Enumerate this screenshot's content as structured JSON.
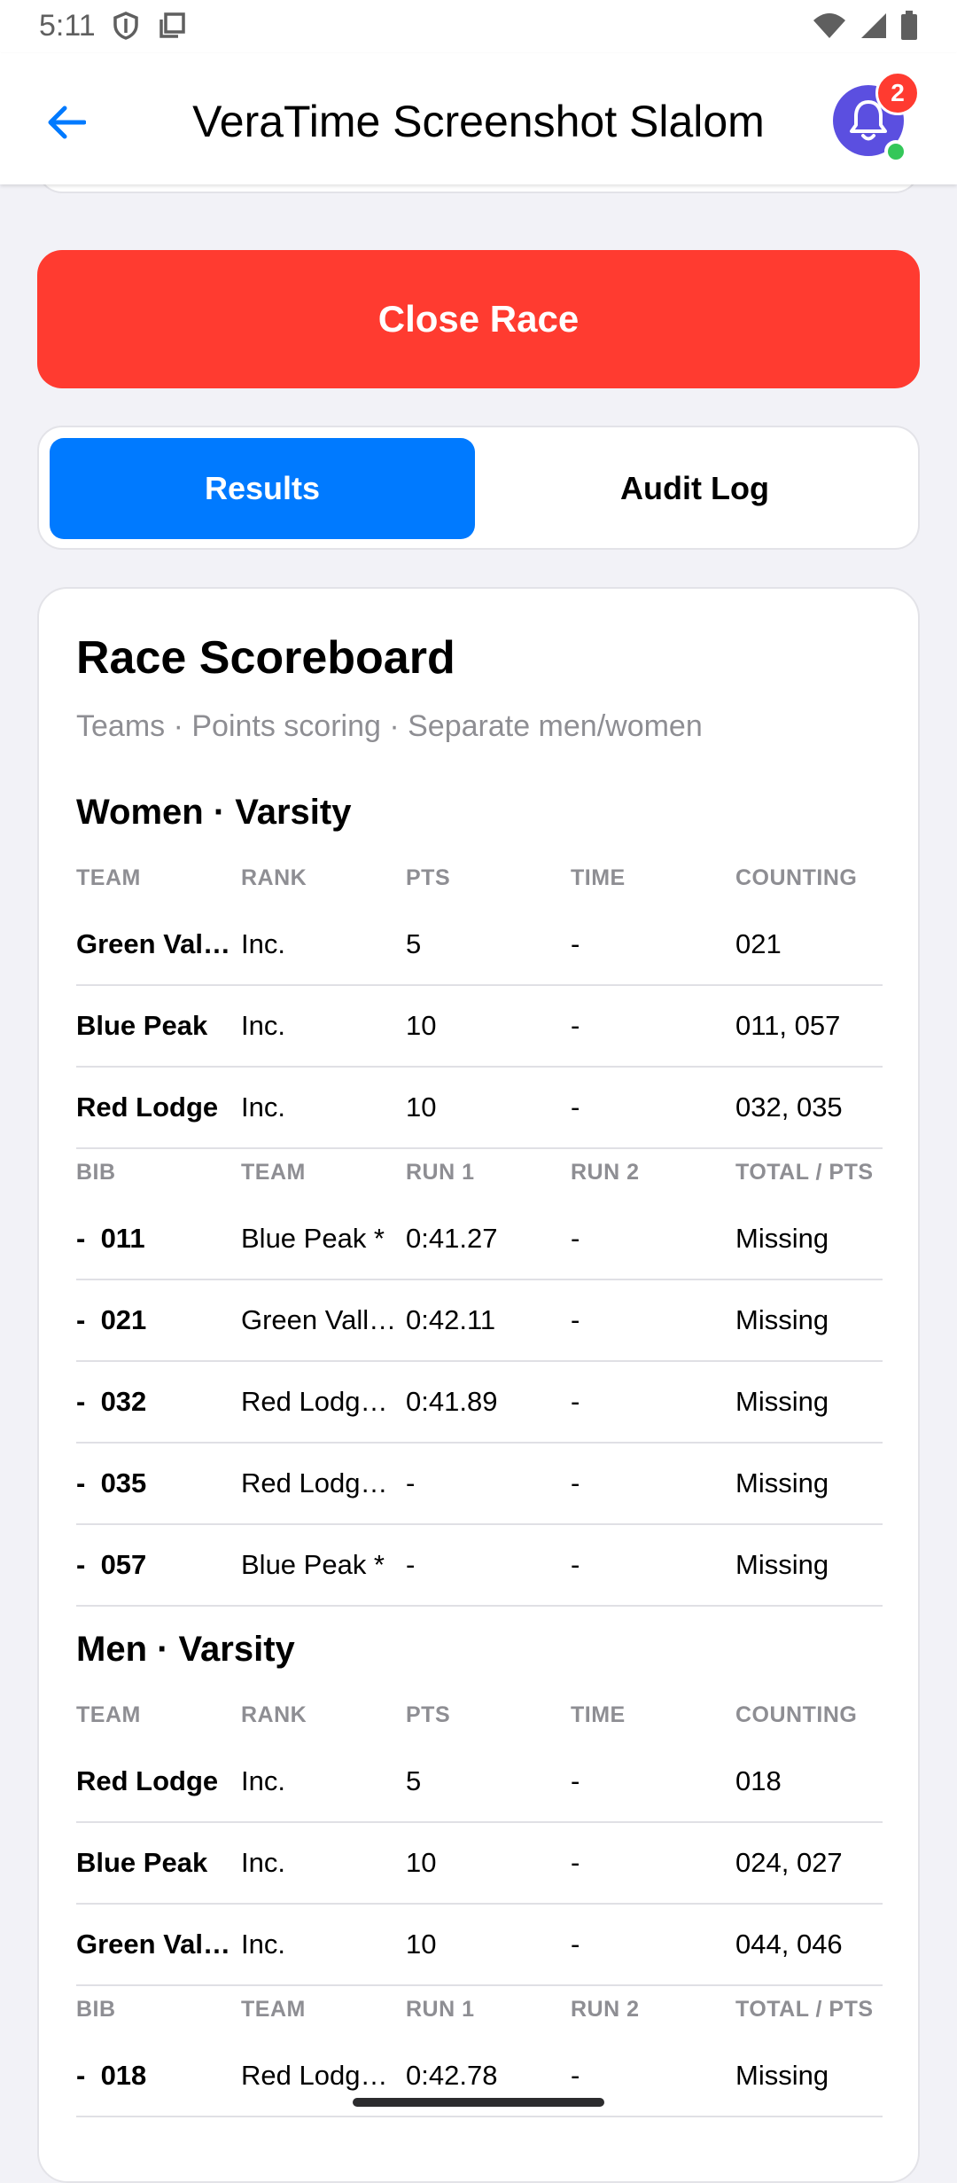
{
  "status": {
    "time": "5:11"
  },
  "header": {
    "title": "VeraTime Screenshot Slalom",
    "notification_count": "2"
  },
  "actions": {
    "close_race": "Close Race"
  },
  "tabs": [
    {
      "label": "Results",
      "active": true
    },
    {
      "label": "Audit Log",
      "active": false
    }
  ],
  "scoreboard": {
    "title": "Race Scoreboard",
    "subtitle": "Teams · Points scoring · Separate men/women",
    "team_headers": [
      "TEAM",
      "RANK",
      "PTS",
      "TIME",
      "COUNTING"
    ],
    "bib_headers": [
      "BIB",
      "TEAM",
      "RUN 1",
      "RUN 2",
      "TOTAL / PTS"
    ],
    "women": {
      "heading": "Women · Varsity",
      "teams": [
        {
          "team": "Green Val…",
          "rank": "Inc.",
          "pts": "5",
          "time": "-",
          "counting": "021"
        },
        {
          "team": "Blue Peak",
          "rank": "Inc.",
          "pts": "10",
          "time": "-",
          "counting": "011, 057"
        },
        {
          "team": "Red Lodge",
          "rank": "Inc.",
          "pts": "10",
          "time": "-",
          "counting": "032, 035"
        }
      ],
      "bibs": [
        {
          "bib": "011",
          "team": "Blue Peak *",
          "run1": "0:41.27",
          "run2": "-",
          "total": "Missing"
        },
        {
          "bib": "021",
          "team": "Green Vall…",
          "run1": "0:42.11",
          "run2": "-",
          "total": "Missing"
        },
        {
          "bib": "032",
          "team": "Red Lodg…",
          "run1": "0:41.89",
          "run2": "-",
          "total": "Missing"
        },
        {
          "bib": "035",
          "team": "Red Lodg…",
          "run1": "-",
          "run2": "-",
          "total": "Missing"
        },
        {
          "bib": "057",
          "team": "Blue Peak *",
          "run1": "-",
          "run2": "-",
          "total": "Missing"
        }
      ]
    },
    "men": {
      "heading": "Men · Varsity",
      "teams": [
        {
          "team": "Red Lodge",
          "rank": "Inc.",
          "pts": "5",
          "time": "-",
          "counting": "018"
        },
        {
          "team": "Blue Peak",
          "rank": "Inc.",
          "pts": "10",
          "time": "-",
          "counting": "024, 027"
        },
        {
          "team": "Green Val…",
          "rank": "Inc.",
          "pts": "10",
          "time": "-",
          "counting": "044, 046"
        }
      ],
      "bibs": [
        {
          "bib": "018",
          "team": "Red Lodg…",
          "run1": "0:42.78",
          "run2": "-",
          "total": "Missing"
        }
      ]
    },
    "bib_prefix": "-"
  },
  "colors": {
    "accent": "#007aff",
    "danger": "#ff3b30",
    "bell": "#5b4fe0",
    "online": "#34c759"
  },
  "icons": [
    "shield-icon",
    "copy-icon",
    "wifi-icon",
    "signal-icon",
    "battery-icon",
    "back-arrow-icon",
    "bell-icon"
  ]
}
